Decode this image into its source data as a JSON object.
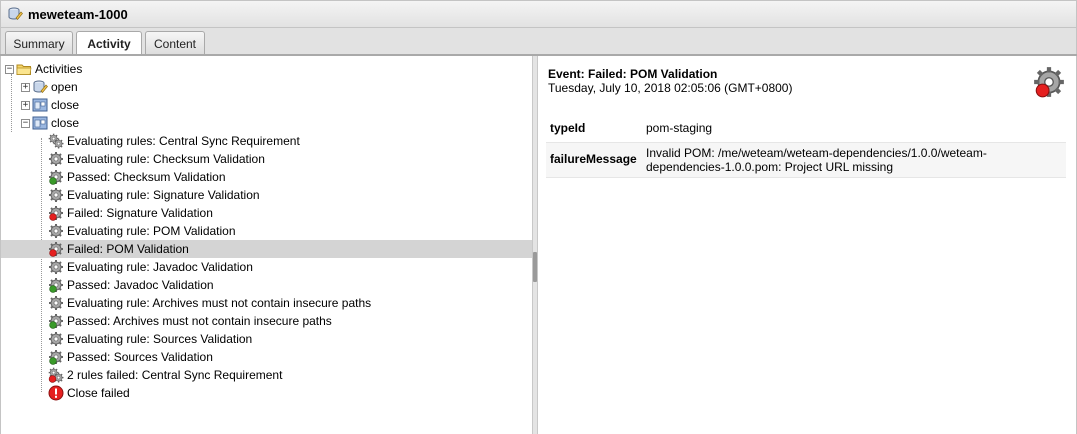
{
  "window": {
    "title": "meweteam-1000"
  },
  "tabs": [
    {
      "label": "Summary",
      "active": false
    },
    {
      "label": "Activity",
      "active": true
    },
    {
      "label": "Content",
      "active": false
    }
  ],
  "tree": {
    "root": {
      "label": "Activities",
      "icon": "folder-icon"
    },
    "groups": [
      {
        "label": "open",
        "icon": "staging-open-icon",
        "expanded": false
      },
      {
        "label": "close",
        "icon": "staging-close-icon",
        "expanded": false
      },
      {
        "label": "close",
        "icon": "staging-close-icon",
        "expanded": true
      }
    ],
    "events": [
      {
        "label": "Evaluating rules: Central Sync Requirement",
        "icon": "gears-icon"
      },
      {
        "label": "Evaluating rule: Checksum Validation",
        "icon": "gear-icon"
      },
      {
        "label": "Passed: Checksum Validation",
        "icon": "gear-passed-icon"
      },
      {
        "label": "Evaluating rule: Signature Validation",
        "icon": "gear-icon"
      },
      {
        "label": "Failed: Signature Validation",
        "icon": "gear-failed-icon"
      },
      {
        "label": "Evaluating rule: POM Validation",
        "icon": "gear-icon"
      },
      {
        "label": "Failed: POM Validation",
        "icon": "gear-failed-icon",
        "selected": true
      },
      {
        "label": "Evaluating rule: Javadoc Validation",
        "icon": "gear-icon"
      },
      {
        "label": "Passed: Javadoc Validation",
        "icon": "gear-passed-icon"
      },
      {
        "label": "Evaluating rule: Archives must not contain insecure paths",
        "icon": "gear-icon"
      },
      {
        "label": "Passed: Archives must not contain insecure paths",
        "icon": "gear-passed-icon"
      },
      {
        "label": "Evaluating rule: Sources Validation",
        "icon": "gear-icon"
      },
      {
        "label": "Passed: Sources Validation",
        "icon": "gear-passed-icon"
      },
      {
        "label": "2 rules failed: Central Sync Requirement",
        "icon": "gears-failed-icon"
      },
      {
        "label": "Close failed",
        "icon": "error-icon"
      }
    ]
  },
  "detail": {
    "title": "Event: Failed: POM Validation",
    "date": "Tuesday, July 10, 2018 02:05:06 (GMT+0800)",
    "properties": [
      {
        "key": "typeId",
        "value": "pom-staging"
      },
      {
        "key": "failureMessage",
        "value": "Invalid POM: /me/weteam/weteam-dependencies/1.0.0/weteam-dependencies-1.0.0.pom: Project URL missing"
      }
    ]
  },
  "colors": {
    "selection": "#d4d4d4",
    "failed": "#e52020",
    "passed": "#3a9a2a",
    "gear": "#9a9a9a"
  }
}
